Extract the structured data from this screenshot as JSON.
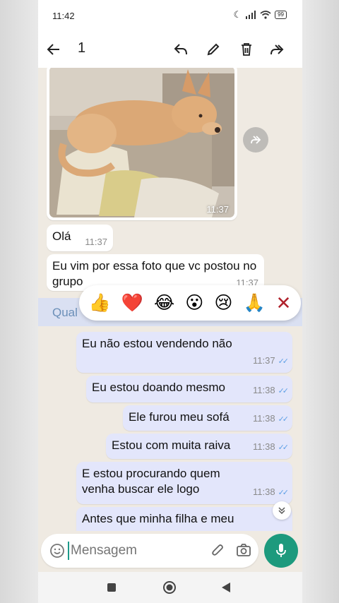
{
  "status_bar": {
    "time": "11:42",
    "battery": "99"
  },
  "app_bar": {
    "selected_count": "1"
  },
  "messages": {
    "photo_time": "11:37",
    "incoming": [
      {
        "text": "Olá",
        "time": "11:37"
      },
      {
        "text": "Eu vim por essa foto que vc postou no grupo",
        "time": "11:37"
      },
      {
        "text": "Qual"
      }
    ],
    "outgoing": [
      {
        "text": "Eu não estou vendendo não",
        "time": "11:37"
      },
      {
        "text": "Eu estou doando mesmo",
        "time": "11:38"
      },
      {
        "text": "Ele furou meu sofá",
        "time": "11:38"
      },
      {
        "text": "Estou com muita raiva",
        "time": "11:38"
      },
      {
        "text": "E estou procurando quem venha buscar ele logo",
        "time": "11:38"
      },
      {
        "text": "Antes que minha filha e meu"
      }
    ]
  },
  "reactions": {
    "emojis": [
      "👍",
      "❤️",
      "😂",
      "😮",
      "😢",
      "🙏"
    ],
    "close": "✕"
  },
  "composer": {
    "placeholder": "Mensagem"
  },
  "colors": {
    "accent": "#1d9a7d",
    "outgoing_bubble": "#e3e6fb",
    "tick": "#5ea0e6"
  }
}
